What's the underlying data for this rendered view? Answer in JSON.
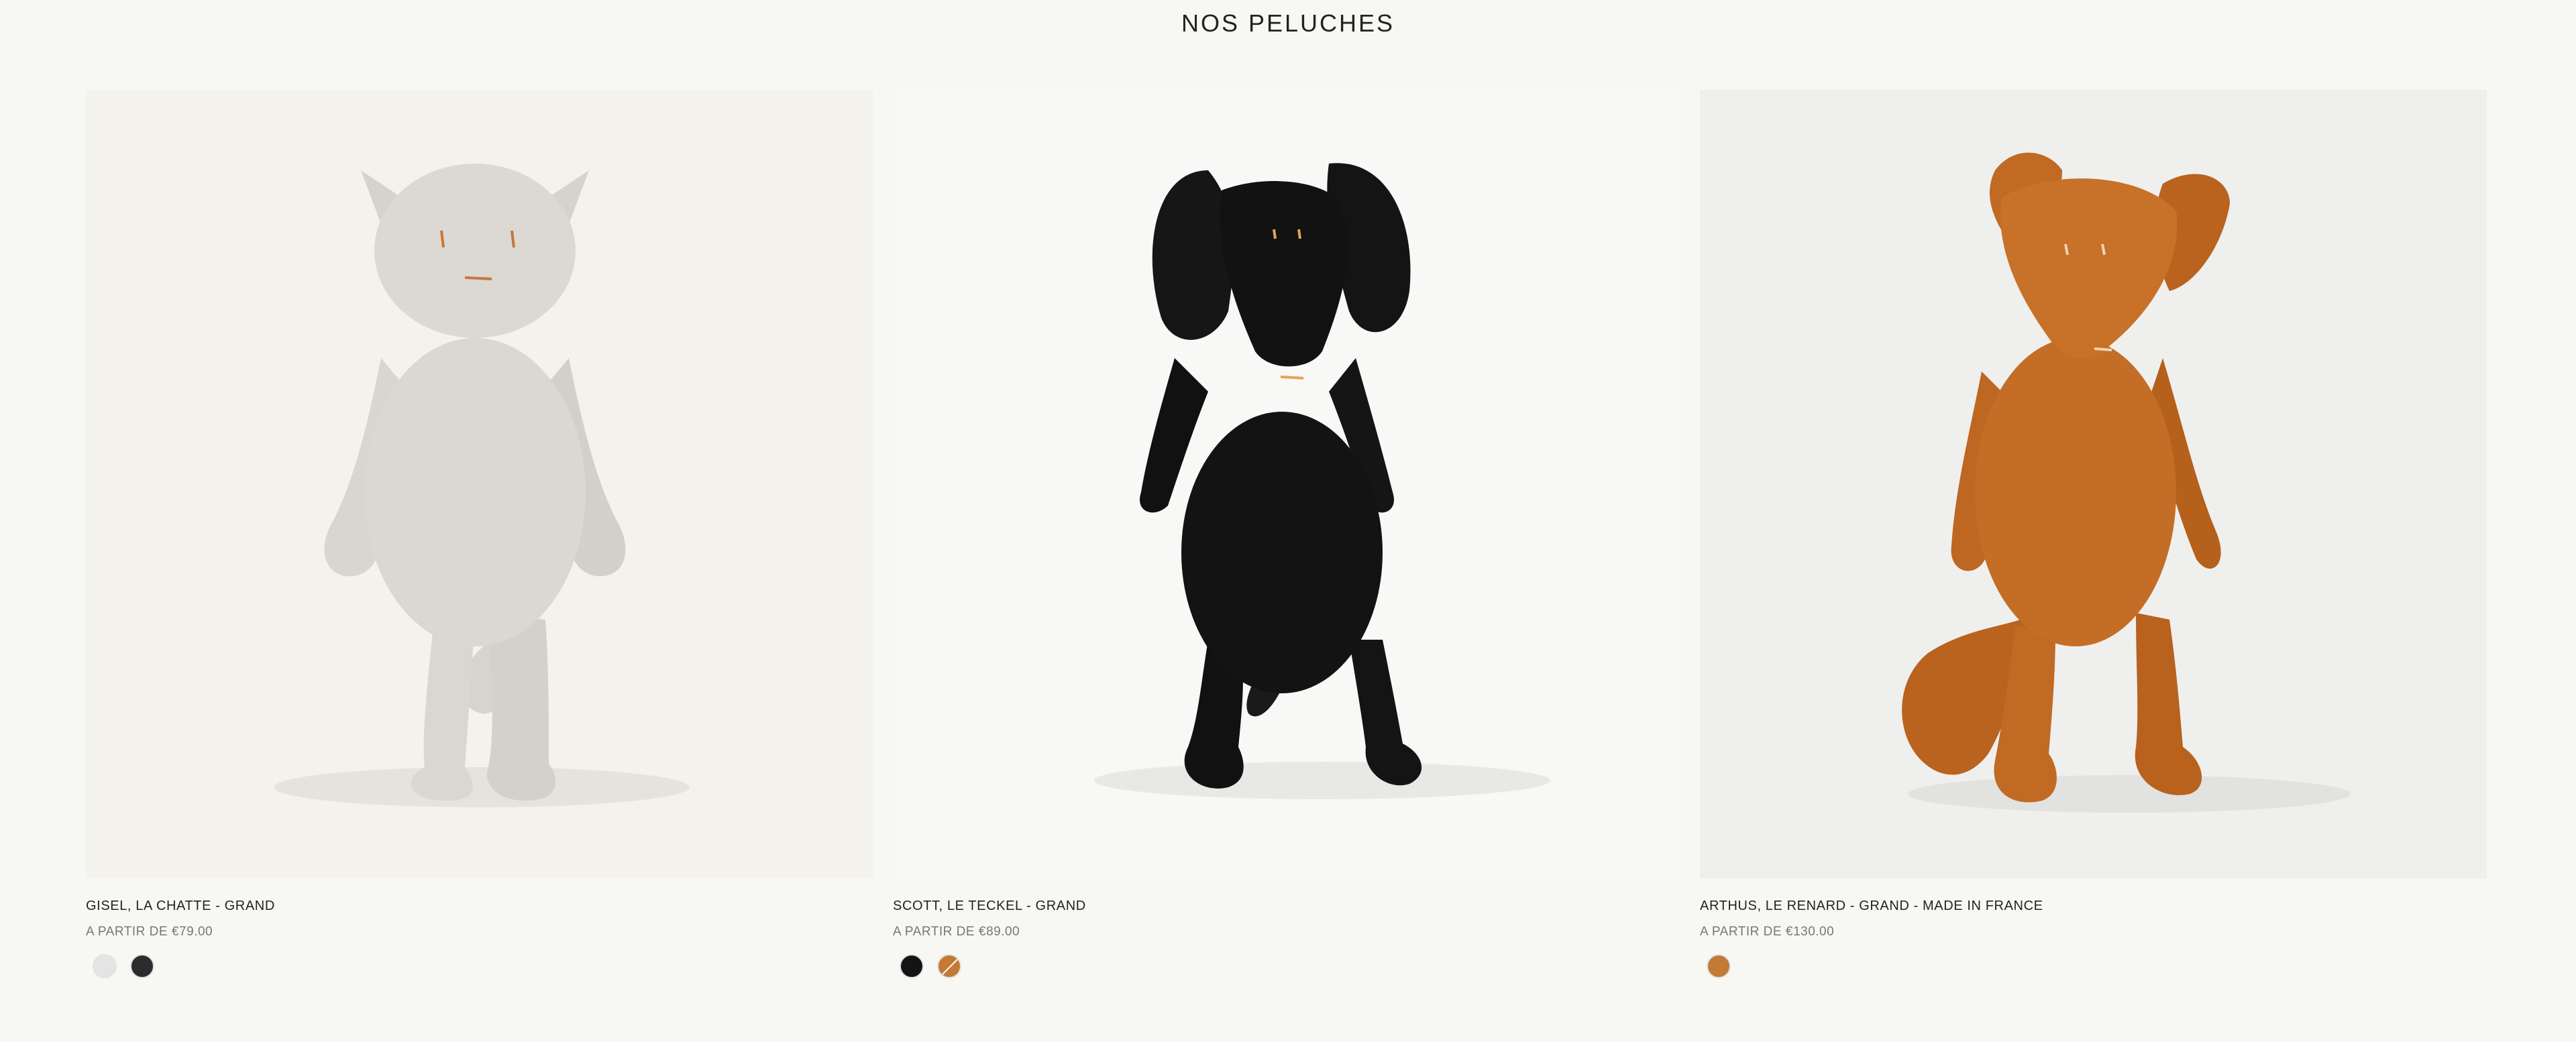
{
  "collection": {
    "title": "NOS PELUCHES"
  },
  "products": [
    {
      "name": "GISEL, LA CHATTE - GRAND",
      "price_label": "A PARTIR DE",
      "price": "€79.00",
      "image_icon": "grey-cat-plush",
      "swatches": [
        {
          "color": "#e4e4e4",
          "struck": false
        },
        {
          "color": "#2c2c2e",
          "struck": false
        }
      ]
    },
    {
      "name": "SCOTT, LE TECKEL - GRAND",
      "price_label": "A PARTIR DE",
      "price": "€89.00",
      "image_icon": "black-dachshund-plush",
      "swatches": [
        {
          "color": "#141414",
          "struck": false
        },
        {
          "color": "#c27a35",
          "struck": true
        }
      ]
    },
    {
      "name": "ARTHUS, LE RENARD - GRAND - MADE IN FRANCE",
      "price_label": "A PARTIR DE",
      "price": "€130.00",
      "image_icon": "orange-fox-plush",
      "swatches": [
        {
          "color": "#c27a35",
          "struck": false
        }
      ]
    }
  ]
}
